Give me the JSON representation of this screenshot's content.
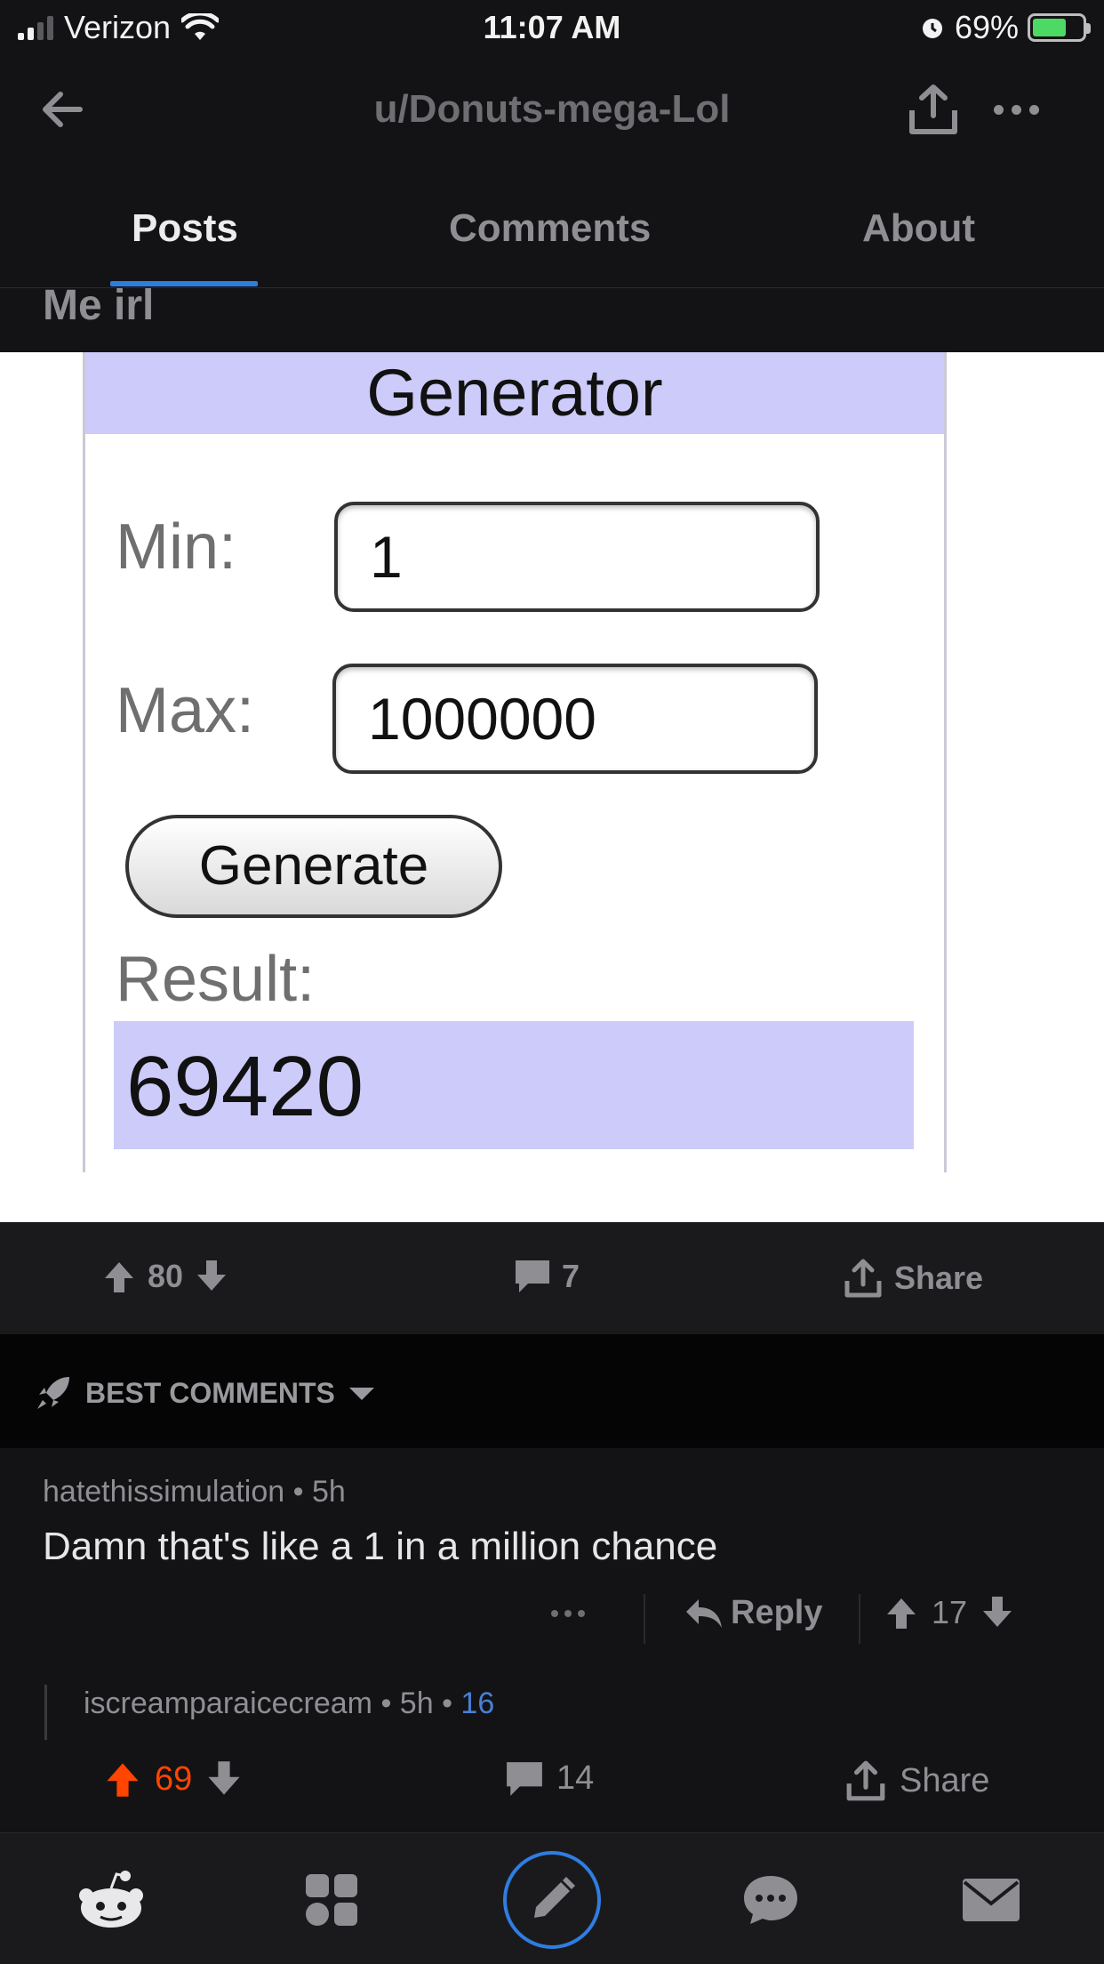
{
  "status_bar": {
    "carrier": "Verizon",
    "time": "11:07 AM",
    "battery_percent": "69%",
    "battery_level": 0.69
  },
  "header": {
    "title": "u/Donuts-mega-Lol"
  },
  "tabs": [
    {
      "label": "Posts",
      "active": true
    },
    {
      "label": "Comments",
      "active": false
    },
    {
      "label": "About",
      "active": false
    }
  ],
  "post": {
    "title": "Me irl",
    "image": {
      "heading": "Generator",
      "min_label": "Min:",
      "min_value": "1",
      "max_label": "Max:",
      "max_value": "1000000",
      "button_label": "Generate",
      "result_label": "Result:",
      "result_value": "69420"
    },
    "score": "80",
    "comment_count": "7",
    "share_label": "Share"
  },
  "comments_sort": {
    "label": "BEST COMMENTS"
  },
  "comment": {
    "author": "hatethissimulation",
    "age": "5h",
    "body": "Damn that's like a 1 in a million chance",
    "reply_label": "Reply",
    "score": "17"
  },
  "reply_preview": {
    "author": "iscreamparaicecream",
    "age": "5h",
    "score": "16"
  },
  "bottom_votes": {
    "score": "69",
    "comments": "14",
    "share_label": "Share"
  },
  "colors": {
    "accent_blue": "#2f7de1",
    "upvote_orange": "#ff4500",
    "generator_lavender": "#cccbf9"
  }
}
